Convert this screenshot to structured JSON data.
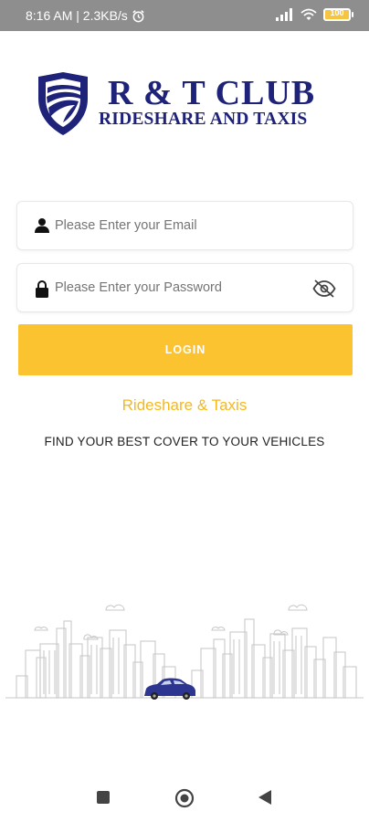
{
  "status_bar": {
    "time_speed": "8:16 AM | 2.3KB/s",
    "icons": [
      "alarm-icon",
      "signal-icon",
      "wifi-icon",
      "battery-icon"
    ],
    "battery_level": "100"
  },
  "logo": {
    "title": "R & T CLUB",
    "subtitle": "RIDESHARE AND TAXIS"
  },
  "login_form": {
    "email_placeholder": "Please Enter your Email",
    "password_placeholder": "Please Enter your Password",
    "login_label": "LOGIN"
  },
  "brand_tagline": "Rideshare & Taxis",
  "tagline": "FIND YOUR BEST COVER TO YOUR VEHICLES",
  "navigation_bar": {
    "buttons": [
      "recents-icon",
      "home-icon",
      "back-icon"
    ]
  },
  "colors": {
    "primary": "#1e2278",
    "accent": "#fbc32f",
    "accent_text": "#f5b81c",
    "status_bar": "#8e8e8e"
  }
}
